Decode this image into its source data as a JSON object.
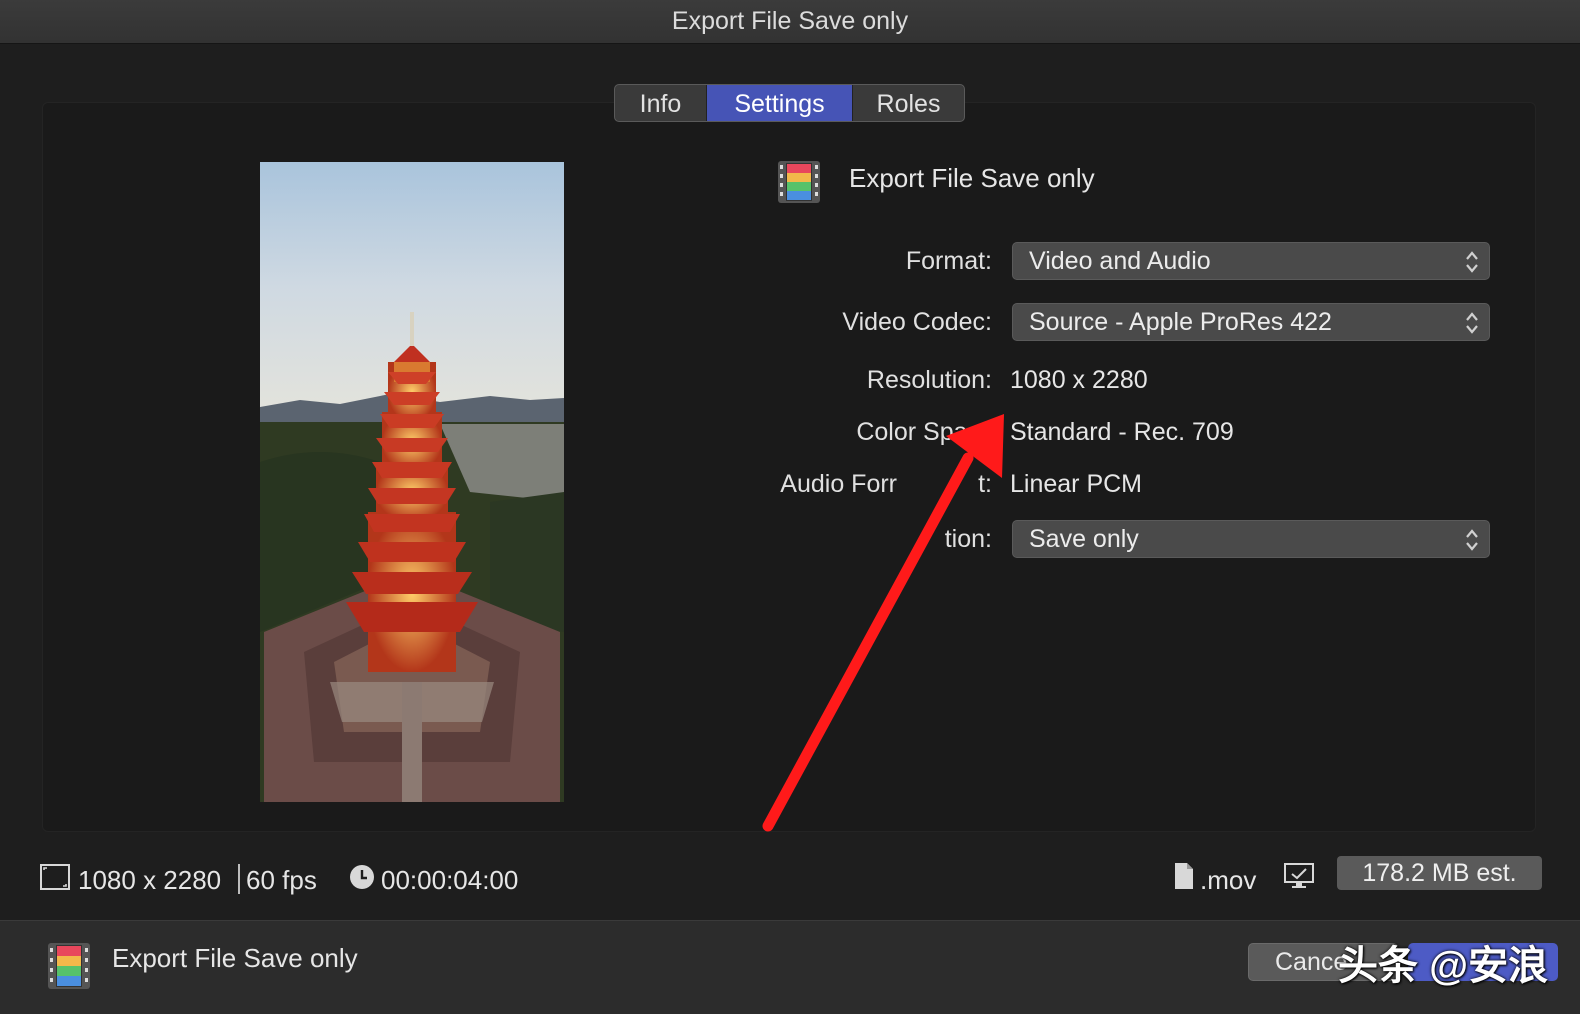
{
  "window": {
    "title": "Export File Save only"
  },
  "tabs": [
    {
      "label": "Info",
      "selected": false
    },
    {
      "label": "Settings",
      "selected": true
    },
    {
      "label": "Roles",
      "selected": false
    }
  ],
  "header": {
    "title": "Export File Save only",
    "icon": "filmstrip-icon"
  },
  "settings": {
    "format": {
      "label": "Format:",
      "value": "Video and Audio"
    },
    "video_codec": {
      "label": "Video Codec:",
      "value": "Source - Apple ProRes 422"
    },
    "resolution": {
      "label": "Resolution:",
      "value": "1080 x 2280"
    },
    "color_space": {
      "label": "Color Spac",
      "value": "Standard - Rec. 709"
    },
    "audio_format": {
      "label_left": "Audio Forr",
      "label_right": "t:",
      "value": "Linear PCM"
    },
    "action": {
      "label": "tion:",
      "value": "Save only"
    }
  },
  "footer": {
    "resolution": "1080 x 2280",
    "fps": "60 fps",
    "duration": "00:00:04:00",
    "extension": ".mov",
    "size_estimate": "178.2 MB est."
  },
  "bottom": {
    "title": "Export File Save only",
    "cancel_label": "Cance",
    "watermark": "头条 @安浪"
  },
  "colors": {
    "accent": "#4654b6",
    "arrow": "#ff1a1a"
  }
}
